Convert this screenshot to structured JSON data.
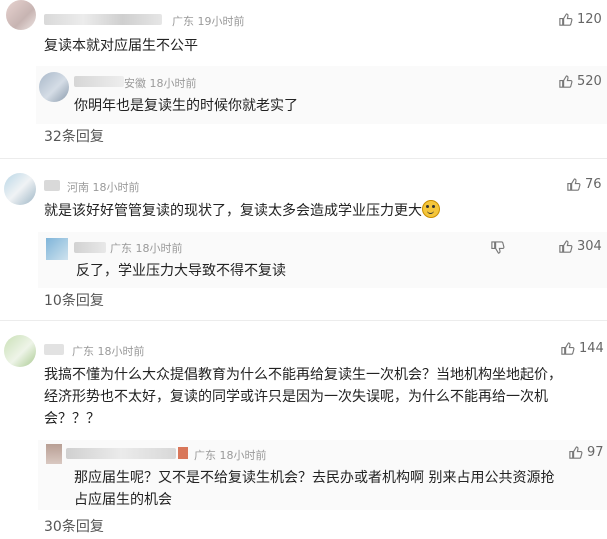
{
  "comments": [
    {
      "location": "广东",
      "time": "19小时前",
      "text": "复读本就对应届生不公平",
      "likes": "120",
      "reply": {
        "location": "安徽",
        "time": "18小时前",
        "text": "你明年也是复读生的时候你就老实了",
        "likes": "520"
      },
      "more_replies": "32条回复"
    },
    {
      "location": "河南",
      "time": "18小时前",
      "text": "就是该好好管管复读的现状了，复读太多会造成学业压力更大",
      "likes": "76",
      "reply": {
        "location": "广东",
        "time": "18小时前",
        "text": "反了，学业压力大导致不得不复读",
        "likes": "304"
      },
      "more_replies": "10条回复"
    },
    {
      "location": "广东",
      "time": "18小时前",
      "text_lines": [
        "我搞不懂为什么大众提倡教育为什么不能再给复读生一次机会？当地机构坐地起价，",
        "经济形势也不太好，复读的同学或许只是因为一次失误呢，为什么不能再给一次机",
        "会？？？"
      ],
      "likes": "144",
      "reply": {
        "location": "广东",
        "time": "18小时前",
        "text_lines": [
          "那应届生呢？又不是不给复读生机会？去民办或者机构啊 别来占用公共资源抢",
          "占应届生的机会"
        ],
        "likes": "97"
      },
      "more_replies": "30条回复"
    }
  ],
  "icons": {
    "like": "thumbs-up-icon",
    "dislike": "thumbs-down-icon",
    "emoji": "smiling-face-emoji"
  },
  "colors": {
    "meta": "#9a9a9a",
    "text": "#222222",
    "more": "#555555"
  }
}
